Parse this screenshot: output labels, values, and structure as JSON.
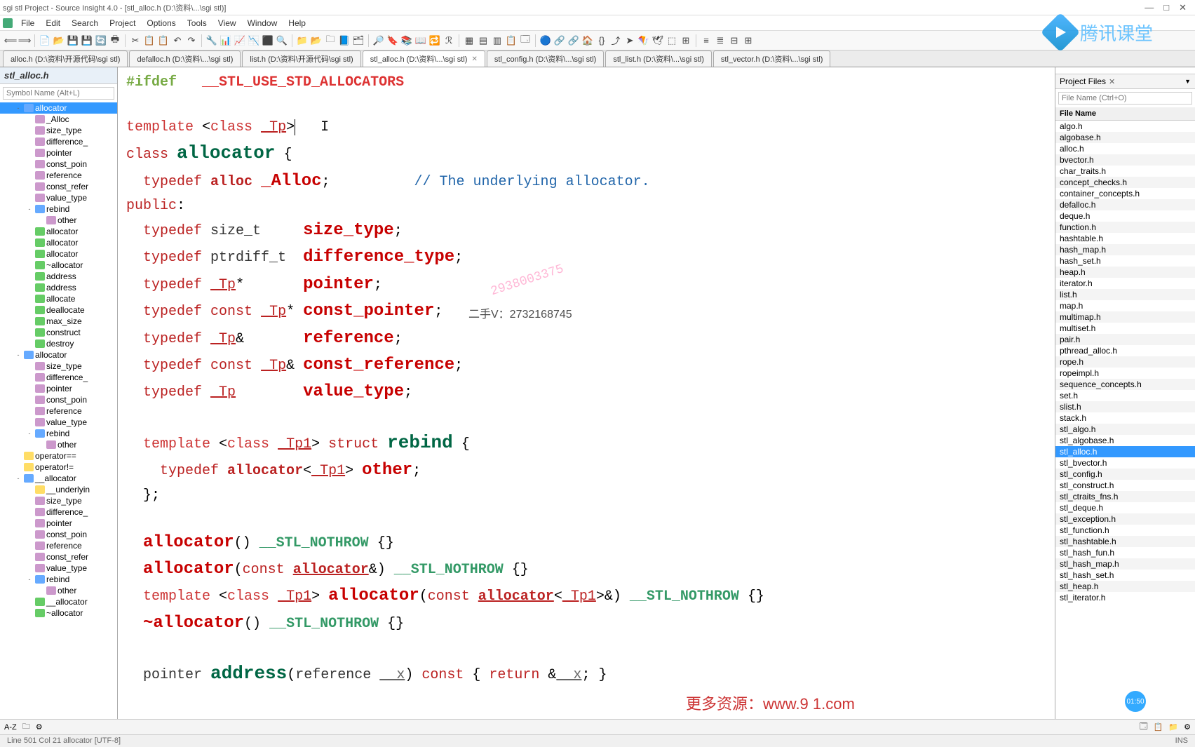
{
  "window": {
    "title": "sgi stl Project - Source Insight 4.0 - [stl_alloc.h (D:\\资料\\...\\sgi stl)]",
    "min": "—",
    "max": "□",
    "close": "✕"
  },
  "menu": [
    "File",
    "Edit",
    "Search",
    "Project",
    "Options",
    "Tools",
    "View",
    "Window",
    "Help"
  ],
  "tabs": [
    {
      "label": "alloc.h (D:\\资料\\开源代码\\sgi stl)",
      "active": false
    },
    {
      "label": "defalloc.h (D:\\资料\\...\\sgi stl)",
      "active": false
    },
    {
      "label": "list.h (D:\\资料\\开源代码\\sgi stl)",
      "active": false
    },
    {
      "label": "stl_alloc.h (D:\\资料\\...\\sgi stl)",
      "active": true
    },
    {
      "label": "stl_config.h (D:\\资料\\...\\sgi stl)",
      "active": false
    },
    {
      "label": "stl_list.h (D:\\资料\\...\\sgi stl)",
      "active": false
    },
    {
      "label": "stl_vector.h (D:\\资料\\...\\sgi stl)",
      "active": false
    }
  ],
  "left": {
    "file_title": "stl_alloc.h",
    "search_placeholder": "Symbol Name (Alt+L)",
    "tree": [
      {
        "l": 0,
        "exp": "-",
        "ic": "ic-blue",
        "t": "allocator",
        "sel": true
      },
      {
        "l": 1,
        "exp": "",
        "ic": "ic-purple",
        "t": "_Alloc"
      },
      {
        "l": 1,
        "exp": "",
        "ic": "ic-purple",
        "t": "size_type"
      },
      {
        "l": 1,
        "exp": "",
        "ic": "ic-purple",
        "t": "difference_"
      },
      {
        "l": 1,
        "exp": "",
        "ic": "ic-purple",
        "t": "pointer"
      },
      {
        "l": 1,
        "exp": "",
        "ic": "ic-purple",
        "t": "const_poin"
      },
      {
        "l": 1,
        "exp": "",
        "ic": "ic-purple",
        "t": "reference"
      },
      {
        "l": 1,
        "exp": "",
        "ic": "ic-purple",
        "t": "const_refer"
      },
      {
        "l": 1,
        "exp": "",
        "ic": "ic-purple",
        "t": "value_type"
      },
      {
        "l": 1,
        "exp": "-",
        "ic": "ic-blue",
        "t": "rebind"
      },
      {
        "l": 2,
        "exp": "",
        "ic": "ic-purple",
        "t": "other"
      },
      {
        "l": 1,
        "exp": "",
        "ic": "ic-green",
        "t": "allocator"
      },
      {
        "l": 1,
        "exp": "",
        "ic": "ic-green",
        "t": "allocator"
      },
      {
        "l": 1,
        "exp": "",
        "ic": "ic-green",
        "t": "allocator"
      },
      {
        "l": 1,
        "exp": "",
        "ic": "ic-green",
        "t": "~allocator"
      },
      {
        "l": 1,
        "exp": "",
        "ic": "ic-green",
        "t": "address"
      },
      {
        "l": 1,
        "exp": "",
        "ic": "ic-green",
        "t": "address"
      },
      {
        "l": 1,
        "exp": "",
        "ic": "ic-green",
        "t": "allocate"
      },
      {
        "l": 1,
        "exp": "",
        "ic": "ic-green",
        "t": "deallocate"
      },
      {
        "l": 1,
        "exp": "",
        "ic": "ic-green",
        "t": "max_size"
      },
      {
        "l": 1,
        "exp": "",
        "ic": "ic-green",
        "t": "construct"
      },
      {
        "l": 1,
        "exp": "",
        "ic": "ic-green",
        "t": "destroy"
      },
      {
        "l": 0,
        "exp": "-",
        "ic": "ic-blue",
        "t": "allocator"
      },
      {
        "l": 1,
        "exp": "",
        "ic": "ic-purple",
        "t": "size_type"
      },
      {
        "l": 1,
        "exp": "",
        "ic": "ic-purple",
        "t": "difference_"
      },
      {
        "l": 1,
        "exp": "",
        "ic": "ic-purple",
        "t": "pointer"
      },
      {
        "l": 1,
        "exp": "",
        "ic": "ic-purple",
        "t": "const_poin"
      },
      {
        "l": 1,
        "exp": "",
        "ic": "ic-purple",
        "t": "reference"
      },
      {
        "l": 1,
        "exp": "",
        "ic": "ic-purple",
        "t": "value_type"
      },
      {
        "l": 1,
        "exp": "-",
        "ic": "ic-blue",
        "t": "rebind"
      },
      {
        "l": 2,
        "exp": "",
        "ic": "ic-purple",
        "t": "other"
      },
      {
        "l": 0,
        "exp": "",
        "ic": "ic-yellow",
        "t": "operator=="
      },
      {
        "l": 0,
        "exp": "",
        "ic": "ic-yellow",
        "t": "operator!="
      },
      {
        "l": 0,
        "exp": "-",
        "ic": "ic-blue",
        "t": "__allocator"
      },
      {
        "l": 1,
        "exp": "",
        "ic": "ic-yellow",
        "t": "__underlyin"
      },
      {
        "l": 1,
        "exp": "",
        "ic": "ic-purple",
        "t": "size_type"
      },
      {
        "l": 1,
        "exp": "",
        "ic": "ic-purple",
        "t": "difference_"
      },
      {
        "l": 1,
        "exp": "",
        "ic": "ic-purple",
        "t": "pointer"
      },
      {
        "l": 1,
        "exp": "",
        "ic": "ic-purple",
        "t": "const_poin"
      },
      {
        "l": 1,
        "exp": "",
        "ic": "ic-purple",
        "t": "reference"
      },
      {
        "l": 1,
        "exp": "",
        "ic": "ic-purple",
        "t": "const_refer"
      },
      {
        "l": 1,
        "exp": "",
        "ic": "ic-purple",
        "t": "value_type"
      },
      {
        "l": 1,
        "exp": "-",
        "ic": "ic-blue",
        "t": "rebind"
      },
      {
        "l": 2,
        "exp": "",
        "ic": "ic-purple",
        "t": "other"
      },
      {
        "l": 1,
        "exp": "",
        "ic": "ic-green",
        "t": "__allocator"
      },
      {
        "l": 1,
        "exp": "",
        "ic": "ic-green",
        "t": "~allocator"
      }
    ]
  },
  "right": {
    "panel_title": "Project Files",
    "search_placeholder": "File Name (Ctrl+O)",
    "col_header": "File Name",
    "files": [
      "algo.h",
      "algobase.h",
      "alloc.h",
      "bvector.h",
      "char_traits.h",
      "concept_checks.h",
      "container_concepts.h",
      "defalloc.h",
      "deque.h",
      "function.h",
      "hashtable.h",
      "hash_map.h",
      "hash_set.h",
      "heap.h",
      "iterator.h",
      "list.h",
      "map.h",
      "multimap.h",
      "multiset.h",
      "pair.h",
      "pthread_alloc.h",
      "rope.h",
      "ropeimpl.h",
      "sequence_concepts.h",
      "set.h",
      "slist.h",
      "stack.h",
      "stl_algo.h",
      "stl_algobase.h",
      "stl_alloc.h",
      "stl_bvector.h",
      "stl_config.h",
      "stl_construct.h",
      "stl_ctraits_fns.h",
      "stl_deque.h",
      "stl_exception.h",
      "stl_function.h",
      "stl_hashtable.h",
      "stl_hash_fun.h",
      "stl_hash_map.h",
      "stl_hash_set.h",
      "stl_heap.h",
      "stl_iterator.h"
    ],
    "selected_file": "stl_alloc.h"
  },
  "code": {
    "ifdef": "#ifdef",
    "ifdef_macro": "__STL_USE_STD_ALLOCATORS",
    "template": "template",
    "class_kw": "class",
    "tp": "_Tp",
    "tp1": "_Tp1",
    "allocator": "allocator",
    "typedef": "typedef",
    "alloc": "alloc",
    "Alloc": "_Alloc",
    "comment_underlying": "// The underlying allocator.",
    "public": "public",
    "size_t": "size_t",
    "size_type": "size_type",
    "ptrdiff_t": "ptrdiff_t",
    "difference_type": "difference_type",
    "pointer": "pointer",
    "const": "const",
    "const_pointer": "const_pointer",
    "reference": "reference",
    "const_reference": "const_reference",
    "value_type": "value_type",
    "struct": "struct",
    "rebind": "rebind",
    "other": "other",
    "nothrow": "__STL_NOTHROW",
    "dtor": "~allocator",
    "return": "return",
    "address": "address",
    "x": "__x"
  },
  "watermarks": {
    "wm1": "2938003375",
    "wm2": "二手V：2732168745",
    "wm3": "更多资源：www.9    1.com",
    "brand": "腾讯课堂",
    "time": "01:50"
  },
  "status": {
    "left": "Line 501  Col 21   allocator [UTF-8]",
    "right": "INS",
    "bottom_az": "A-Z"
  }
}
